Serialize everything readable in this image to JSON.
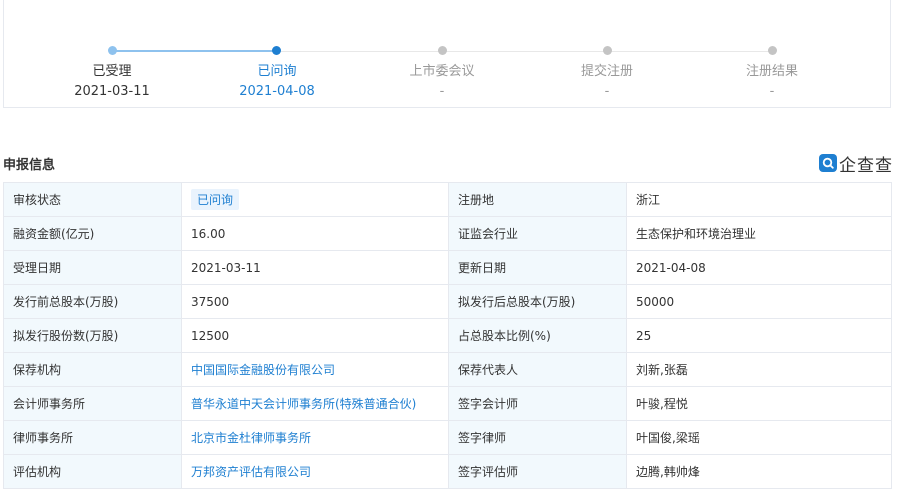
{
  "progress": {
    "steps": [
      {
        "label": "已受理",
        "date": "2021-03-11",
        "state": "done"
      },
      {
        "label": "已问询",
        "date": "2021-04-08",
        "state": "current"
      },
      {
        "label": "上市委会议",
        "date": "-",
        "state": "pending"
      },
      {
        "label": "提交注册",
        "date": "-",
        "state": "pending"
      },
      {
        "label": "注册结果",
        "date": "-",
        "state": "pending"
      }
    ]
  },
  "section": {
    "title": "申报信息",
    "brand": "企查查"
  },
  "info": {
    "rows": [
      {
        "k1": "审核状态",
        "v1": "已问询",
        "k2": "注册地",
        "v2": "浙江"
      },
      {
        "k1": "融资金额(亿元)",
        "v1": "16.00",
        "k2": "证监会行业",
        "v2": "生态保护和环境治理业"
      },
      {
        "k1": "受理日期",
        "v1": "2021-03-11",
        "k2": "更新日期",
        "v2": "2021-04-08"
      },
      {
        "k1": "发行前总股本(万股)",
        "v1": "37500",
        "k2": "拟发行后总股本(万股)",
        "v2": "50000"
      },
      {
        "k1": "拟发行股份数(万股)",
        "v1": "12500",
        "k2": "占总股本比例(%)",
        "v2": "25"
      },
      {
        "k1": "保荐机构",
        "v1": "中国国际金融股份有限公司",
        "k2": "保荐代表人",
        "v2": "刘新,张磊"
      },
      {
        "k1": "会计师事务所",
        "v1": "普华永道中天会计师事务所(特殊普通合伙)",
        "k2": "签字会计师",
        "v2": "叶骏,程悦"
      },
      {
        "k1": "律师事务所",
        "v1": "北京市金杜律师事务所",
        "k2": "签字律师",
        "v2": "叶国俊,梁瑶"
      },
      {
        "k1": "评估机构",
        "v1": "万邦资产评估有限公司",
        "k2": "签字评估师",
        "v2": "边腾,韩帅烽"
      }
    ]
  },
  "colors": {
    "accent": "#1e7fd1",
    "done_dot": "#8ec2ee",
    "current_dot": "#1e7fd1",
    "pending_dot": "#c4c4c4",
    "pending_text": "#999999",
    "key_bg": "#f2f9fd",
    "border": "#e6e9ef"
  }
}
